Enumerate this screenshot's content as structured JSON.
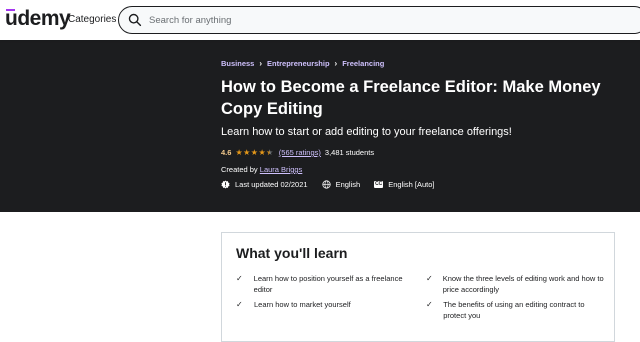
{
  "header": {
    "logo_main": "ūdemy",
    "categories_label": "Categories",
    "search_placeholder": "Search for anything"
  },
  "breadcrumb": [
    "Business",
    "Entrepreneurship",
    "Freelancing"
  ],
  "course": {
    "title": "How to Become a Freelance Editor: Make Money Copy Editing",
    "subtitle": "Learn how to start or add editing to your freelance offerings!",
    "rating_score": "4.6",
    "stars": 4.5,
    "ratings_count": "(565 ratings)",
    "students": "3,481 students",
    "created_by_label": "Created by",
    "instructor": "Laura Briggs",
    "last_updated": "Last updated 02/2021",
    "language": "English",
    "captions": "English [Auto]"
  },
  "learn": {
    "heading": "What you'll learn",
    "items": [
      "Learn how to position yourself as a freelance editor",
      "Know the three levels of editing work and how to price accordingly",
      "Learn how to market yourself",
      "The benefits of using an editing contract to protect you"
    ]
  },
  "colors": {
    "brand": "#a435f0",
    "hero_bg": "#1c1d1f",
    "link_purple": "#cec0fc",
    "star": "#e59819"
  }
}
